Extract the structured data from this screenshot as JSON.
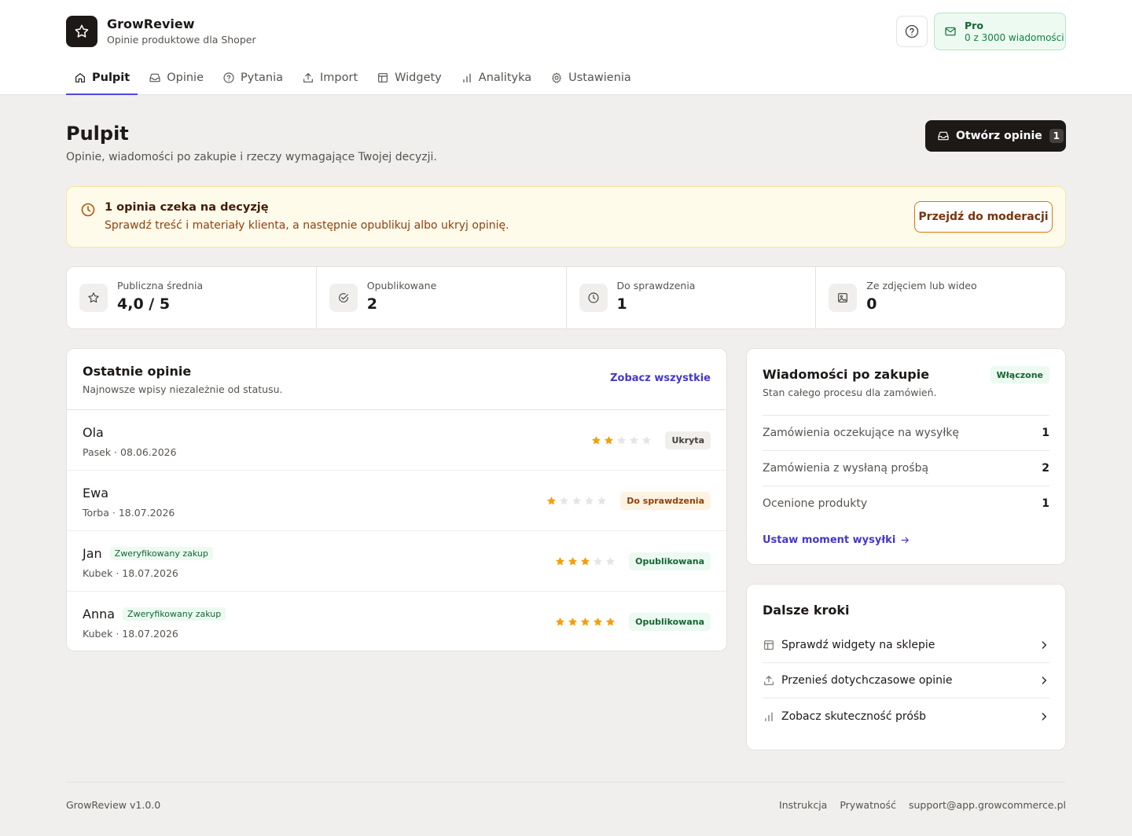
{
  "app": {
    "name": "GrowReview",
    "subtitle": "Opinie produktowe dla Shoper"
  },
  "plan": {
    "name": "Pro",
    "usage": "0 z 3000 wiadomości"
  },
  "tabs": [
    {
      "label": "Pulpit",
      "icon": "home-icon",
      "active": true
    },
    {
      "label": "Opinie",
      "icon": "inbox-icon",
      "active": false
    },
    {
      "label": "Pytania",
      "icon": "question-icon",
      "active": false
    },
    {
      "label": "Import",
      "icon": "upload-icon",
      "active": false
    },
    {
      "label": "Widgety",
      "icon": "layout-icon",
      "active": false
    },
    {
      "label": "Analityka",
      "icon": "bar-chart-icon",
      "active": false
    },
    {
      "label": "Ustawienia",
      "icon": "gear-icon",
      "active": false
    }
  ],
  "page": {
    "title": "Pulpit",
    "subtitle": "Opinie, wiadomości po zakupie i rzeczy wymagające Twojej decyzji.",
    "open_button": "Otwórz opinie",
    "open_count": "1"
  },
  "alert": {
    "title": "1 opinia czeka na decyzję",
    "text": "Sprawdź treść i materiały klienta, a następnie opublikuj albo ukryj opinię.",
    "button": "Przejdź do moderacji"
  },
  "stats": [
    {
      "label": "Publiczna średnia",
      "value": "4,0 / 5",
      "icon": "star-icon"
    },
    {
      "label": "Opublikowane",
      "value": "2",
      "icon": "check-circle-icon"
    },
    {
      "label": "Do sprawdzenia",
      "value": "1",
      "icon": "clock-icon"
    },
    {
      "label": "Ze zdjęciem lub wideo",
      "value": "0",
      "icon": "image-icon"
    }
  ],
  "recent": {
    "title": "Ostatnie opinie",
    "subtitle": "Najnowsze wpisy niezależnie od statusu.",
    "see_all": "Zobacz wszystkie",
    "reviews": [
      {
        "name": "Ola",
        "verified": "",
        "meta": "Pasek · 08.06.2026",
        "rating": 2,
        "status": "Ukryta",
        "status_type": "hidden"
      },
      {
        "name": "Ewa",
        "verified": "",
        "meta": "Torba · 18.07.2026",
        "rating": 1,
        "status": "Do sprawdzenia",
        "status_type": "pending"
      },
      {
        "name": "Jan",
        "verified": "Zweryfikowany zakup",
        "meta": "Kubek · 18.07.2026",
        "rating": 3,
        "status": "Opublikowana",
        "status_type": "published"
      },
      {
        "name": "Anna",
        "verified": "Zweryfikowany zakup",
        "meta": "Kubek · 18.07.2026",
        "rating": 5,
        "status": "Opublikowana",
        "status_type": "published"
      }
    ]
  },
  "messages": {
    "title": "Wiadomości po zakupie",
    "subtitle": "Stan całego procesu dla zamówień.",
    "badge": "Włączone",
    "rows": [
      {
        "label": "Zamówienia oczekujące na wysyłkę",
        "value": "1"
      },
      {
        "label": "Zamówienia z wysłaną prośbą",
        "value": "2"
      },
      {
        "label": "Ocenione produkty",
        "value": "1"
      }
    ],
    "link": "Ustaw moment wysyłki"
  },
  "next_steps": {
    "title": "Dalsze kroki",
    "items": [
      {
        "label": "Sprawdź widgety na sklepie",
        "icon": "layout-icon"
      },
      {
        "label": "Przenieś dotychczasowe opinie",
        "icon": "upload-icon"
      },
      {
        "label": "Zobacz skuteczność próśb",
        "icon": "bar-chart-icon"
      }
    ]
  },
  "footer": {
    "version": "GrowReview v1.0.0",
    "links": [
      "Instrukcja",
      "Prywatność",
      "support@app.growcommerce.pl"
    ]
  },
  "colors": {
    "accent": "#4f46e5",
    "link": "#4338ca",
    "star": "#f59e0b",
    "star_empty": "#e7e5e4",
    "dark": "#1c1917"
  }
}
